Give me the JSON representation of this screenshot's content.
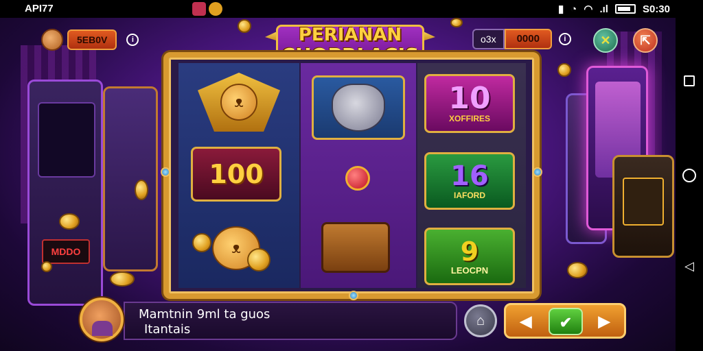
{
  "status_bar": {
    "left_text": "API77",
    "time": "S0:30",
    "signal_label": ".ıl"
  },
  "hud": {
    "balance_value": "5EB0V",
    "bet_label": "o3x",
    "bet_value": "0000",
    "info_glyph": "i",
    "settings_icon": "wrench-icon",
    "menu_icon": "exit-icon"
  },
  "title": {
    "line1": "PERIANAN",
    "line2": "CHOPRLACIS"
  },
  "reels": {
    "reel1": {
      "tile_100": "100"
    },
    "reel3": {
      "tile_10_big": "10",
      "tile_10_small": "XOFFIRES",
      "tile_16_big": "16",
      "tile_16_small": "IAFORD",
      "tile_9_big": "9",
      "tile_9_small": "LEOCPN"
    }
  },
  "machine_display": "MDDO",
  "message": {
    "line1": "Mamtnin 9ml ta guos",
    "line2": "Itantais"
  },
  "controls": {
    "left_arrow": "◀",
    "ok": "✔",
    "right_arrow": "▶",
    "house_icon": "home-icon"
  },
  "colors": {
    "accent_gold": "#d89a30",
    "purple_bg": "#4a1680",
    "orange_button": "#f0a030",
    "green_ok": "#60d040"
  }
}
